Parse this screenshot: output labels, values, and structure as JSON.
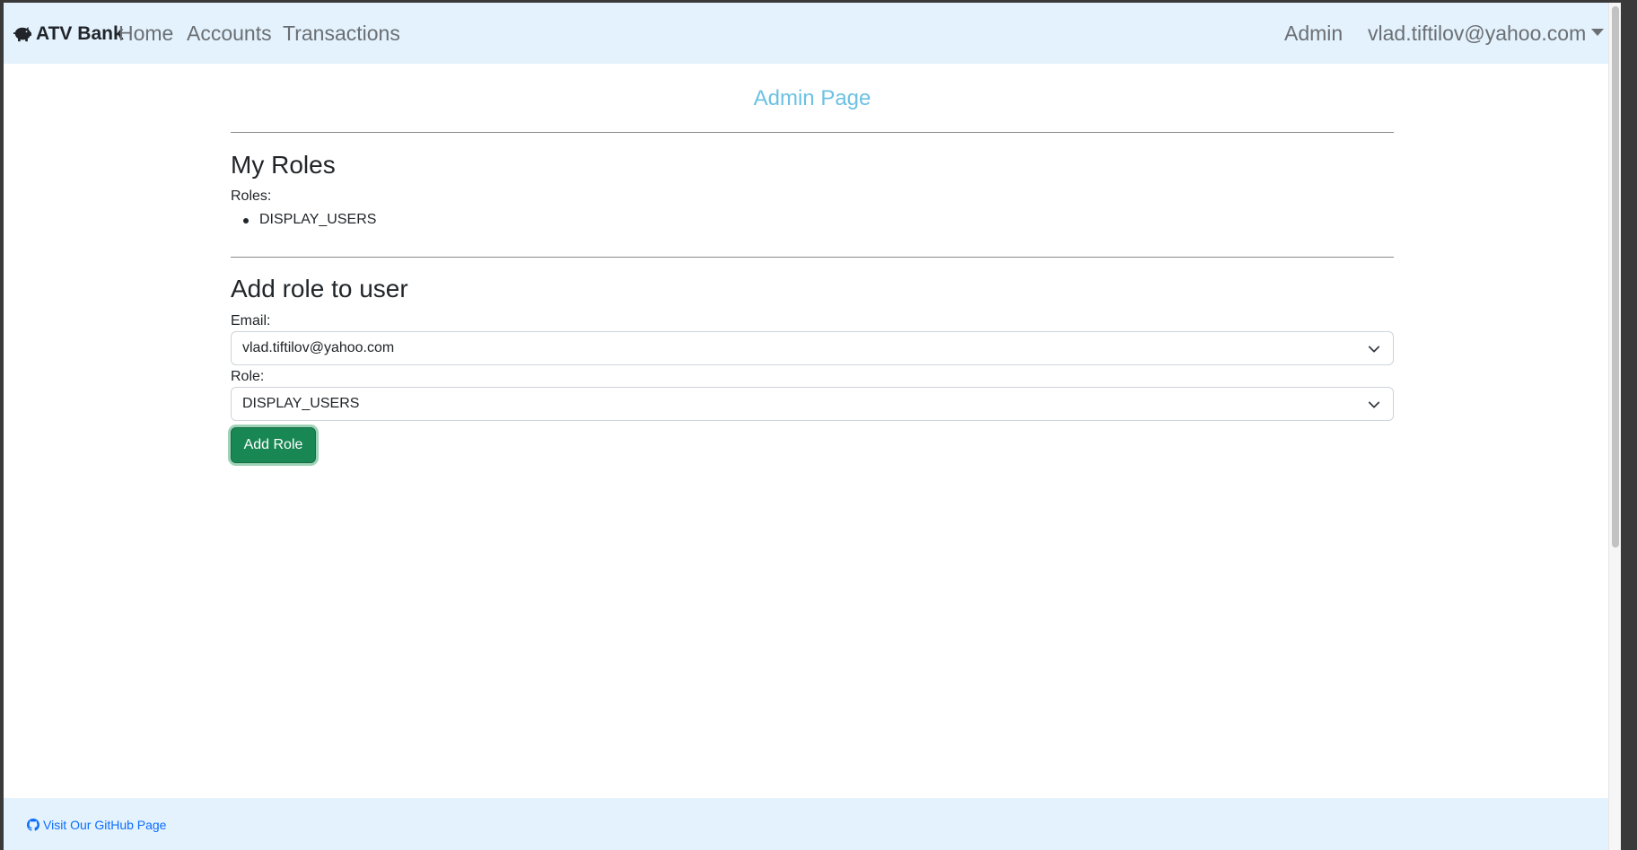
{
  "navbar": {
    "brand": "ATV Bank",
    "brand_icon": "piggy-bank-icon",
    "links": [
      "Home",
      "Accounts",
      "Transactions"
    ],
    "admin_label": "Admin",
    "user_email": "vlad.tiftilov@yahoo.com"
  },
  "page": {
    "title": "Admin Page"
  },
  "my_roles": {
    "heading": "My Roles",
    "roles_label": "Roles:",
    "roles": [
      "DISPLAY_USERS"
    ]
  },
  "add_role": {
    "heading": "Add role to user",
    "email_label": "Email:",
    "email_value": "vlad.tiftilov@yahoo.com",
    "role_label": "Role:",
    "role_value": "DISPLAY_USERS",
    "button_label": "Add Role"
  },
  "footer": {
    "github_link": "Visit Our GitHub Page",
    "github_icon": "github-icon"
  },
  "colors": {
    "navbar_bg": "#e3f2fd",
    "title": "#6cc1e3",
    "button": "#198754",
    "link": "#0d6efd"
  }
}
